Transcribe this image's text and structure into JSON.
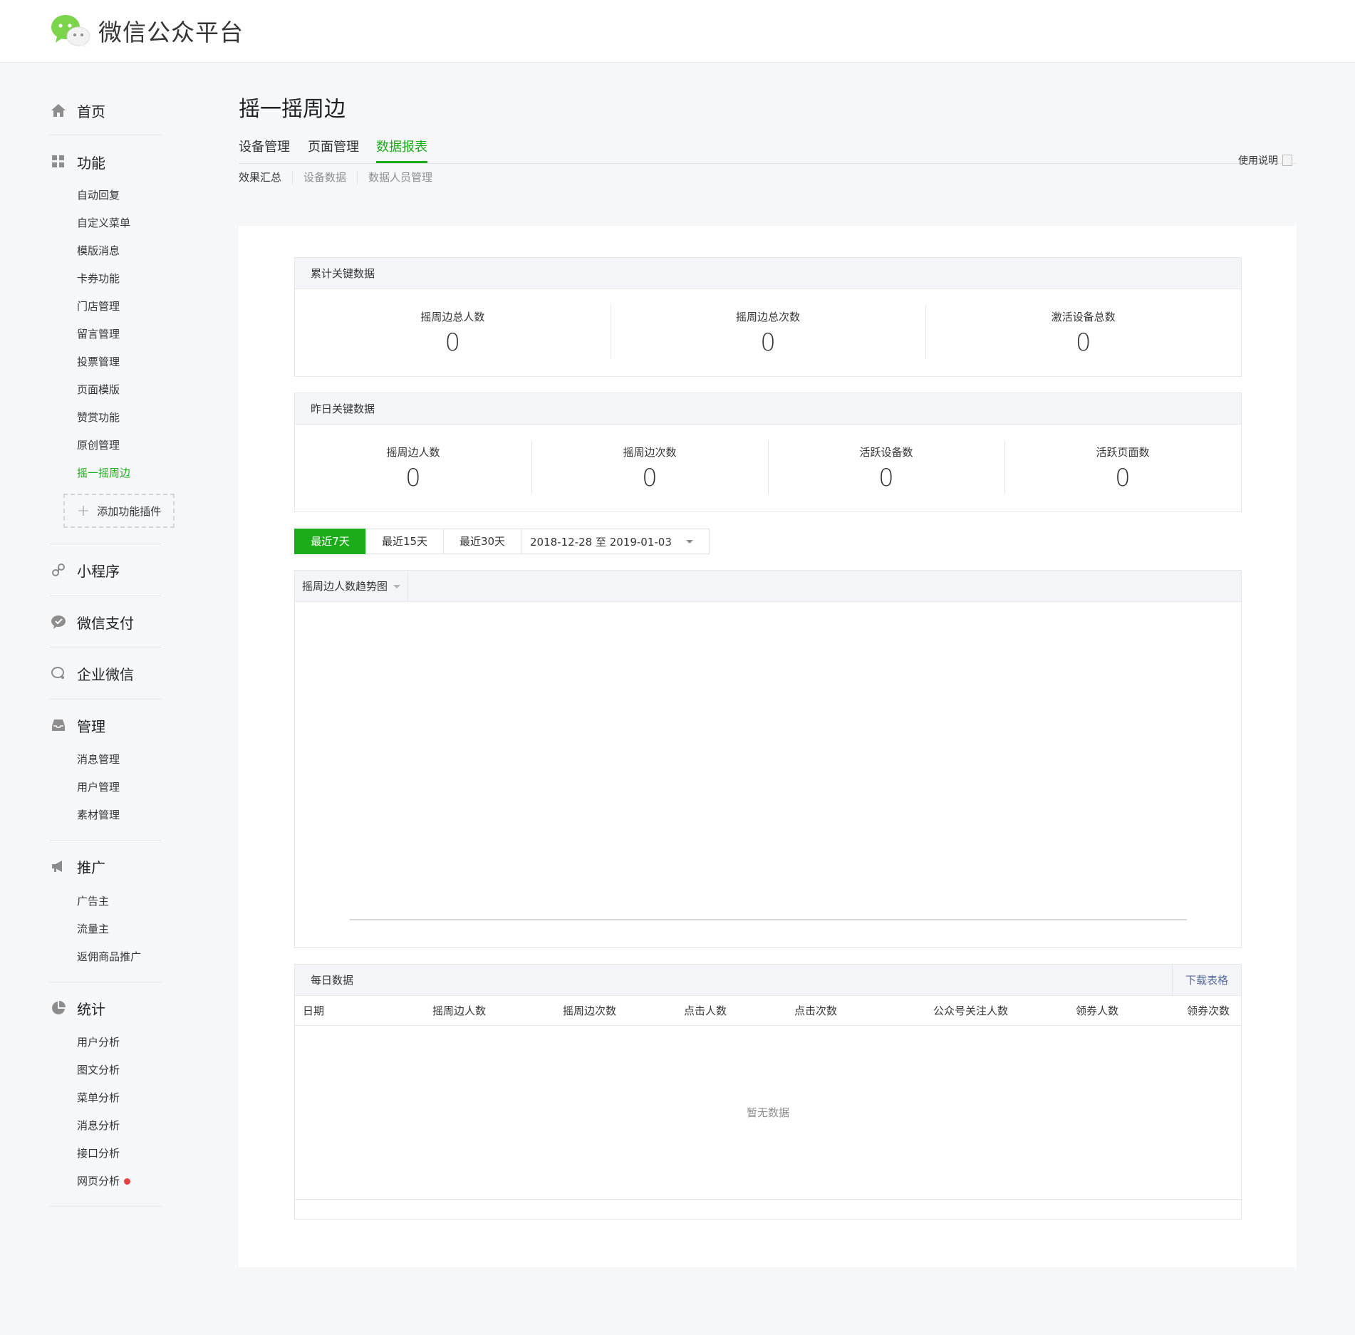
{
  "app": {
    "title": "微信公众平台"
  },
  "sidebar": {
    "home": "首页",
    "features": {
      "label": "功能",
      "items": [
        "自动回复",
        "自定义菜单",
        "模版消息",
        "卡券功能",
        "门店管理",
        "留言管理",
        "投票管理",
        "页面模版",
        "赞赏功能",
        "原创管理",
        "摇一摇周边"
      ],
      "active_index": 10,
      "add_plugin": "添加功能插件"
    },
    "miniprogram": "小程序",
    "wxpay": "微信支付",
    "work_wechat": "企业微信",
    "manage": {
      "label": "管理",
      "items": [
        "消息管理",
        "用户管理",
        "素材管理"
      ]
    },
    "promote": {
      "label": "推广",
      "items": [
        "广告主",
        "流量主",
        "返佣商品推广"
      ]
    },
    "stats": {
      "label": "统计",
      "items": [
        "用户分析",
        "图文分析",
        "菜单分析",
        "消息分析",
        "接口分析",
        "网页分析"
      ],
      "badge_index": 5
    }
  },
  "page": {
    "title": "摇一摇周边",
    "tabs": [
      "设备管理",
      "页面管理",
      "数据报表"
    ],
    "active_tab": 2,
    "help": "使用说明",
    "subtabs": [
      "效果汇总",
      "设备数据",
      "数据人员管理"
    ]
  },
  "cumulative": {
    "title": "累计关键数据",
    "items": [
      {
        "label": "摇周边总人数",
        "value": "0"
      },
      {
        "label": "摇周边总次数",
        "value": "0"
      },
      {
        "label": "激活设备总数",
        "value": "0"
      }
    ]
  },
  "yesterday": {
    "title": "昨日关键数据",
    "items": [
      {
        "label": "摇周边人数",
        "value": "0"
      },
      {
        "label": "摇周边次数",
        "value": "0"
      },
      {
        "label": "活跃设备数",
        "value": "0"
      },
      {
        "label": "活跃页面数",
        "value": "0"
      }
    ]
  },
  "range": {
    "buttons": [
      "最近7天",
      "最近15天",
      "最近30天"
    ],
    "active": 0,
    "date_range": "2018-12-28 至 2019-01-03"
  },
  "chart": {
    "selector": "摇周边人数趋势图"
  },
  "daily": {
    "title": "每日数据",
    "download": "下载表格",
    "columns": [
      "日期",
      "摇周边人数",
      "摇周边次数",
      "点击人数",
      "点击次数",
      "公众号关注人数",
      "领券人数",
      "领券次数"
    ],
    "empty": "暂无数据"
  },
  "colors": {
    "accent": "#1aad19",
    "link": "#576b95",
    "badge": "#e64340"
  }
}
